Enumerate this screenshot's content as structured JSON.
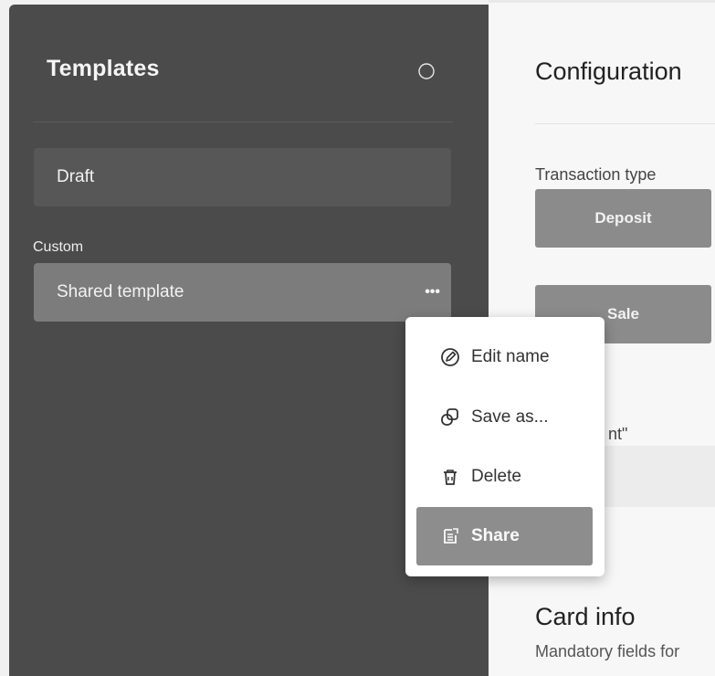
{
  "sidebar": {
    "title": "Templates",
    "items": [
      {
        "label": "Draft"
      }
    ],
    "section_label": "Custom",
    "custom_items": [
      {
        "label": "Shared template",
        "more": "•••"
      }
    ]
  },
  "context_menu": {
    "items": [
      {
        "label": "Edit name",
        "icon": "edit-icon"
      },
      {
        "label": "Save as...",
        "icon": "copy-icon"
      },
      {
        "label": "Delete",
        "icon": "trash-icon"
      },
      {
        "label": "Share",
        "icon": "share-icon",
        "selected": true
      }
    ]
  },
  "main": {
    "title": "Configuration",
    "transaction_type_label": "Transaction type",
    "options": [
      "Deposit",
      "Sale"
    ],
    "amount_label": "nt\"",
    "card_title": "Card info",
    "card_subtitle": "Mandatory fields for"
  },
  "colors": {
    "sidebar_bg": "#4b4b4b",
    "selected_item": "#7c7c7c",
    "option_button": "#8b8b8b",
    "menu_selected": "#8d8d8d"
  }
}
